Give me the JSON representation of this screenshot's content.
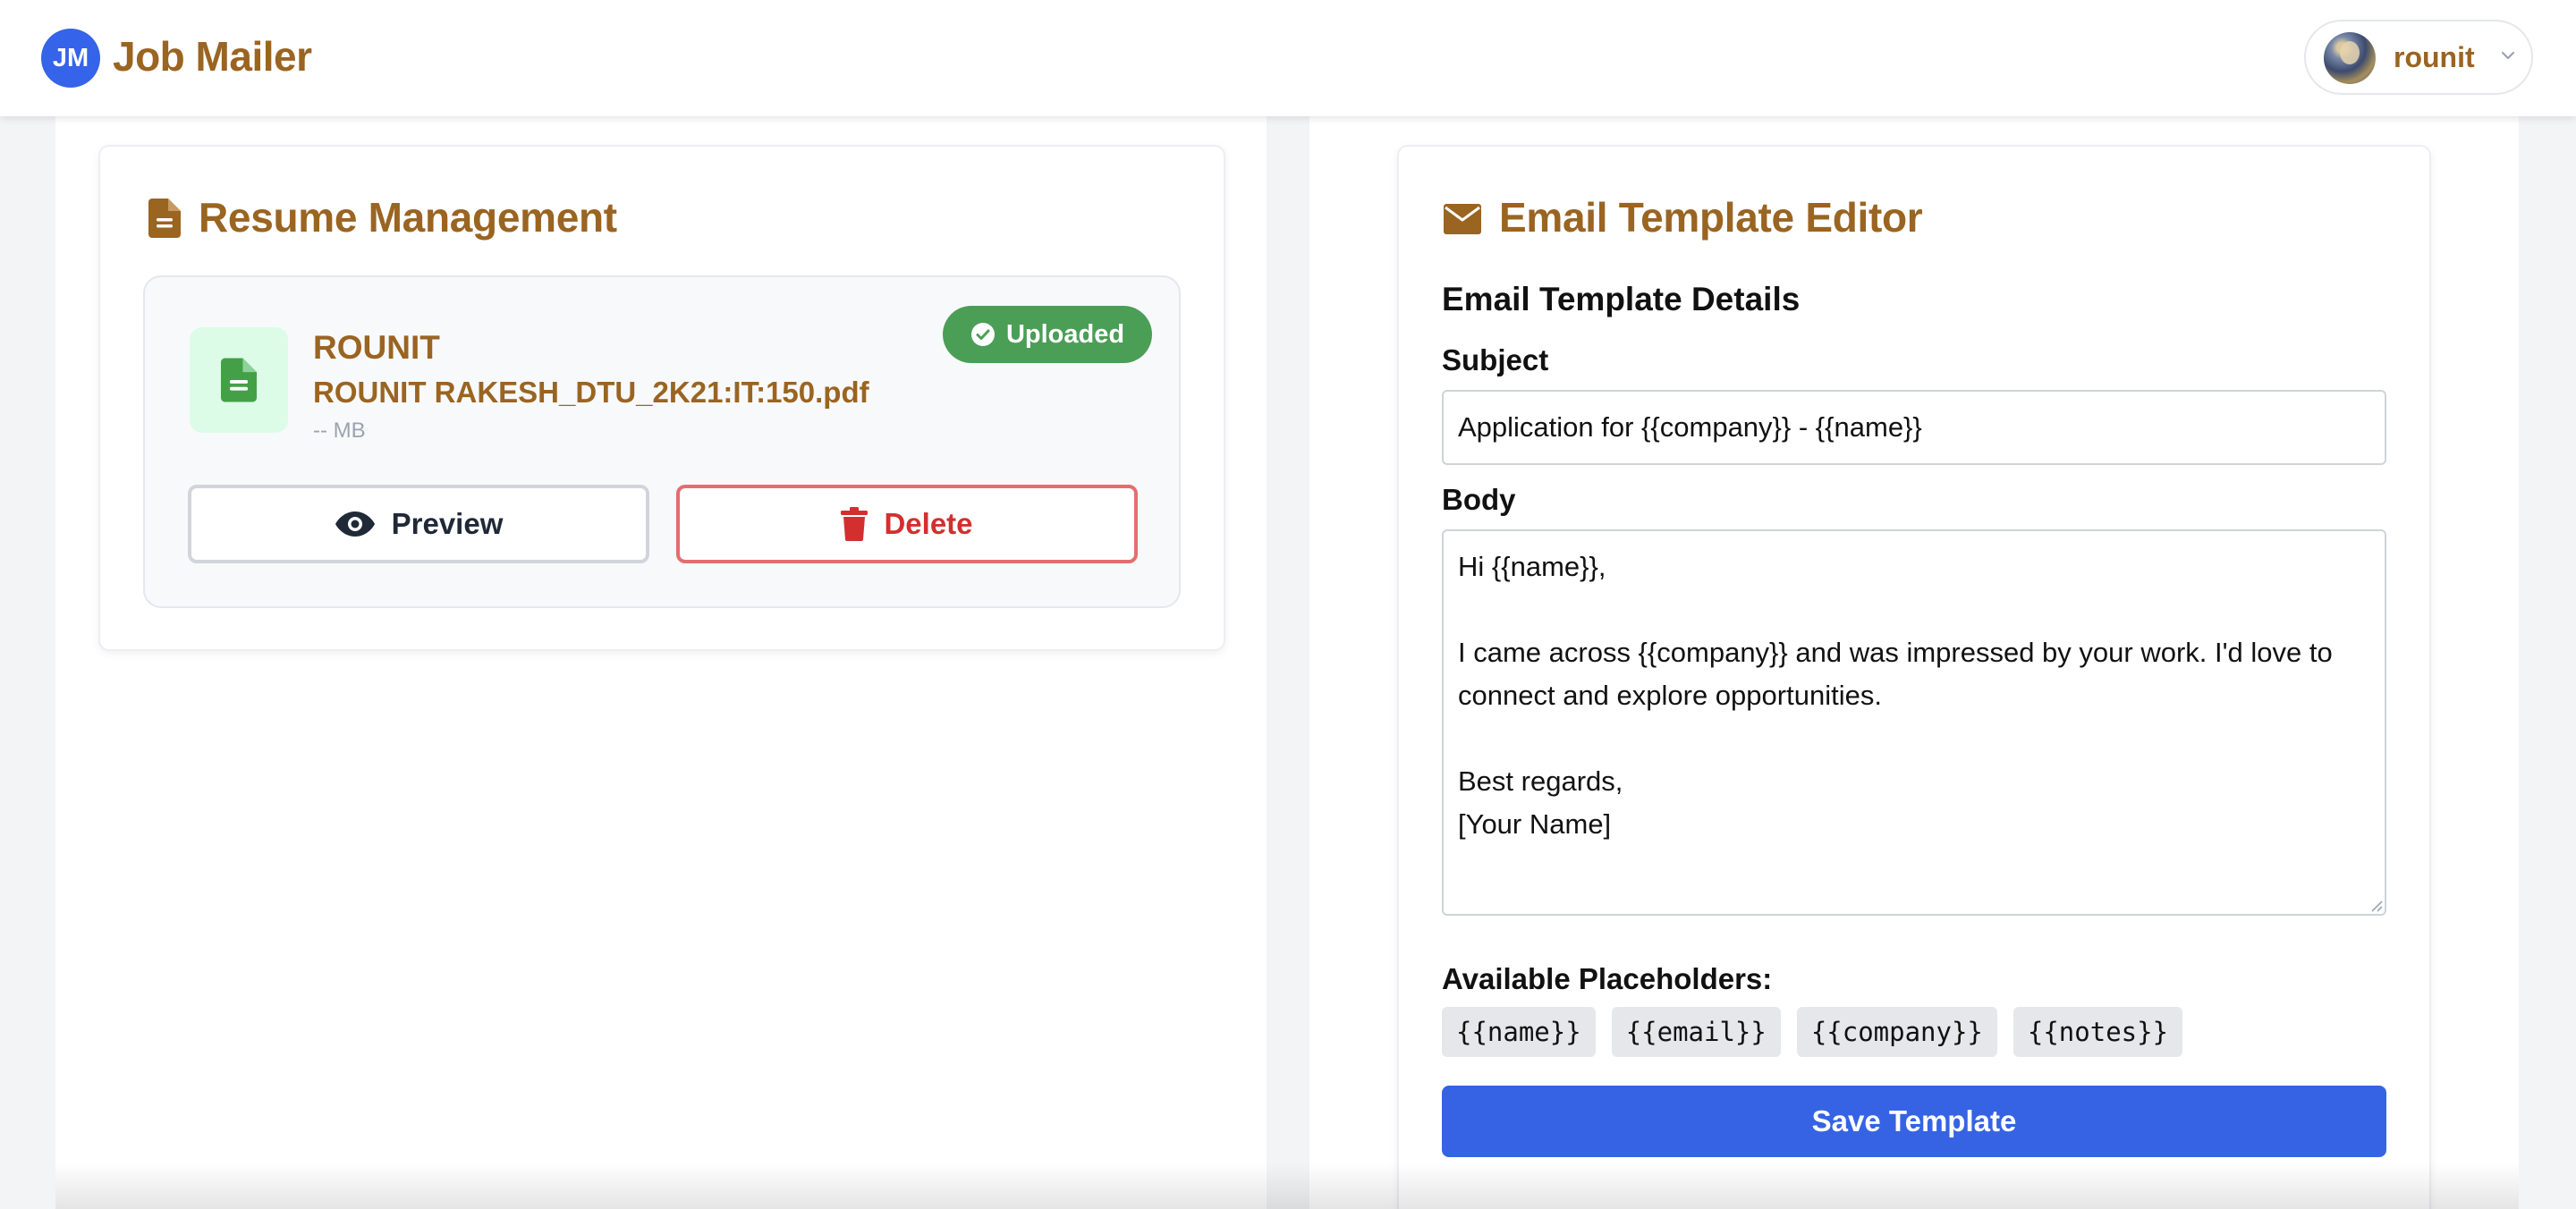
{
  "header": {
    "logo_text": "JM",
    "app_title": "Job Mailer",
    "user_name": "rounit"
  },
  "resume": {
    "title": "Resume Management",
    "file_owner": "ROUNIT",
    "file_name": "ROUNIT RAKESH_DTU_2K21:IT:150.pdf",
    "file_size": "-- MB",
    "status_badge": "Uploaded",
    "preview_label": "Preview",
    "delete_label": "Delete"
  },
  "email": {
    "title": "Email Template Editor",
    "section_heading": "Email Template Details",
    "subject_label": "Subject",
    "subject_value": "Application for {{company}} - {{name}}",
    "body_label": "Body",
    "body_value": "Hi {{name}},\n\nI came across {{company}} and was impressed by your work. I'd love to connect and explore opportunities.\n\nBest regards,\n[Your Name]",
    "placeholders_label": "Available Placeholders:",
    "placeholders": [
      "{{name}}",
      "{{email}}",
      "{{company}}",
      "{{notes}}"
    ],
    "save_label": "Save Template"
  },
  "colors": {
    "brand_blue": "#3563e9",
    "brand_brown": "#9a6421",
    "success_green": "#4b9e56",
    "danger_red": "#d32f2f"
  },
  "icons": {
    "resume_title": "document-icon",
    "email_title": "envelope-icon",
    "file": "document-icon",
    "badge": "check-circle-icon",
    "preview": "eye-icon",
    "delete": "trash-icon",
    "user_menu": "chevron-down-icon"
  }
}
